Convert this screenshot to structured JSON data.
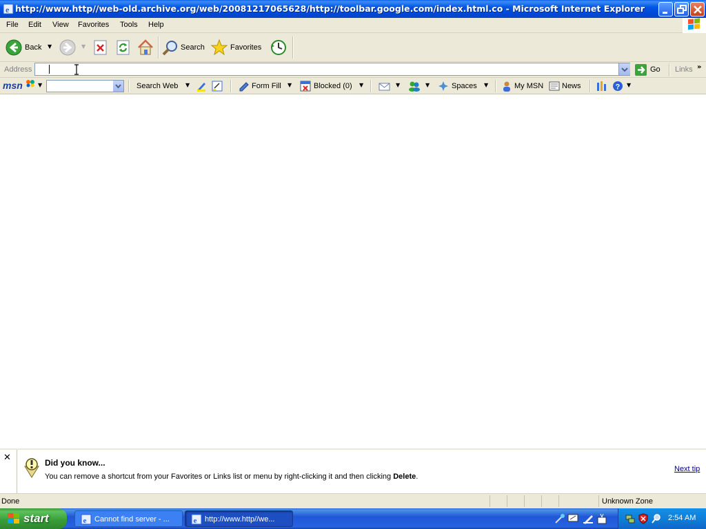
{
  "window": {
    "title": "http://www.http//web-old.archive.org/web/20081217065628/http://toolbar.google.com/index.html.co - Microsoft Internet Explorer"
  },
  "menu": [
    "File",
    "Edit",
    "View",
    "Favorites",
    "Tools",
    "Help"
  ],
  "toolbar": {
    "back_label": "Back",
    "search_label": "Search",
    "favorites_label": "Favorites"
  },
  "address": {
    "label": "Address",
    "value": "",
    "go_label": "Go",
    "links_label": "Links"
  },
  "msn_toolbar": {
    "logo": "msn",
    "search_value": "",
    "search_web_label": "Search Web",
    "form_fill_label": "Form Fill",
    "blocked_label": "Blocked (0)",
    "spaces_label": "Spaces",
    "my_msn_label": "My MSN",
    "news_label": "News"
  },
  "tip": {
    "title": "Did you know...",
    "body_prefix": "You can remove a shortcut from your Favorites or Links list or menu by right-clicking it and then clicking ",
    "body_bold": "Delete",
    "body_suffix": ".",
    "next_label": "Next tip"
  },
  "status": {
    "text": "Done",
    "zone": "Unknown Zone"
  },
  "taskbar": {
    "start_label": "start",
    "tasks": [
      {
        "label": "Cannot find server - ..."
      },
      {
        "label": "http://www.http//we..."
      }
    ],
    "clock": "2:54 AM"
  },
  "colors": {
    "titlebar": "#0055e5",
    "chrome": "#ece9d8",
    "taskbar": "#245edb",
    "start_green": "#3c9a3c"
  }
}
